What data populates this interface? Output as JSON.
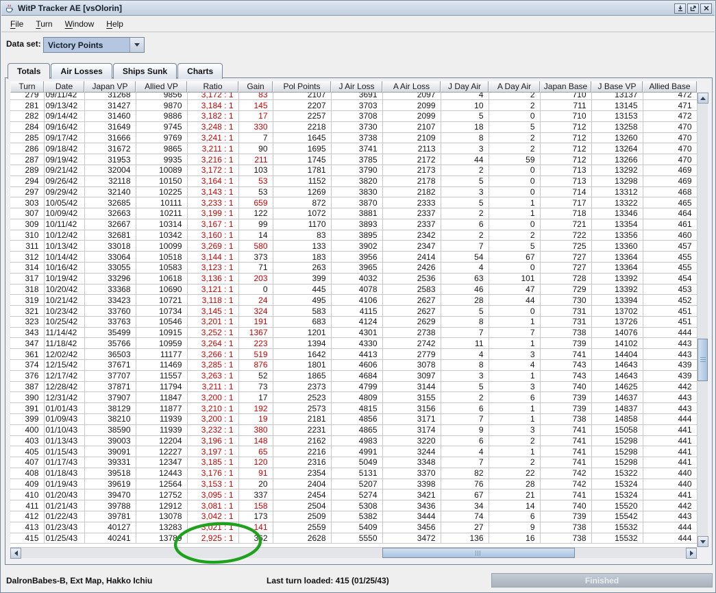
{
  "window": {
    "title": "WitP Tracker AE [vsOlorin]"
  },
  "menu": {
    "items": [
      {
        "label": "File",
        "mnemonic_index": 0
      },
      {
        "label": "Turn",
        "mnemonic_index": 0
      },
      {
        "label": "Window",
        "mnemonic_index": 0
      },
      {
        "label": "Help",
        "mnemonic_index": 0
      }
    ]
  },
  "dataset": {
    "label": "Data set:",
    "value": "Victory Points"
  },
  "tabs": [
    {
      "label": "Totals",
      "selected": true
    },
    {
      "label": "Air Losses",
      "selected": false
    },
    {
      "label": "Ships Sunk",
      "selected": false
    },
    {
      "label": "Charts",
      "selected": false
    }
  ],
  "table": {
    "columns": [
      "Turn",
      "Date",
      "Japan VP",
      "Allied VP",
      "Ratio",
      "Gain",
      "Pol Points",
      "J Air Loss",
      "A Air Loss",
      "J Day Air",
      "A Day Air",
      "Japan Base",
      "J Base VP",
      "Allied Base"
    ],
    "rows": [
      {
        "cells": [
          "279",
          "09/11/42",
          "31268",
          "9856",
          "3,172 : 1",
          "83",
          "2107",
          "3691",
          "2097",
          "4",
          "2",
          "710",
          "13137",
          "472"
        ],
        "gain_red": true
      },
      {
        "cells": [
          "281",
          "09/13/42",
          "31427",
          "9870",
          "3,184 : 1",
          "145",
          "2207",
          "3703",
          "2099",
          "10",
          "2",
          "711",
          "13145",
          "471"
        ],
        "gain_red": true
      },
      {
        "cells": [
          "282",
          "09/14/42",
          "31460",
          "9886",
          "3,182 : 1",
          "17",
          "2257",
          "3708",
          "2099",
          "5",
          "0",
          "710",
          "13153",
          "472"
        ],
        "gain_red": true
      },
      {
        "cells": [
          "284",
          "09/16/42",
          "31649",
          "9745",
          "3,248 : 1",
          "330",
          "2218",
          "3730",
          "2107",
          "18",
          "5",
          "712",
          "13258",
          "470"
        ],
        "gain_red": true
      },
      {
        "cells": [
          "285",
          "09/17/42",
          "31666",
          "9769",
          "3,241 : 1",
          "7",
          "1645",
          "3738",
          "2109",
          "8",
          "2",
          "712",
          "13260",
          "470"
        ],
        "gain_red": false
      },
      {
        "cells": [
          "286",
          "09/18/42",
          "31672",
          "9865",
          "3,211 : 1",
          "90",
          "1695",
          "3741",
          "2113",
          "3",
          "2",
          "712",
          "13264",
          "470"
        ],
        "gain_red": false
      },
      {
        "cells": [
          "287",
          "09/19/42",
          "31953",
          "9935",
          "3,216 : 1",
          "211",
          "1745",
          "3785",
          "2172",
          "44",
          "59",
          "712",
          "13266",
          "470"
        ],
        "gain_red": true
      },
      {
        "cells": [
          "289",
          "09/21/42",
          "32004",
          "10089",
          "3,172 : 1",
          "103",
          "1781",
          "3790",
          "2173",
          "2",
          "0",
          "713",
          "13292",
          "469"
        ],
        "gain_red": false
      },
      {
        "cells": [
          "294",
          "09/26/42",
          "32118",
          "10150",
          "3,164 : 1",
          "53",
          "1152",
          "3820",
          "2178",
          "5",
          "0",
          "713",
          "13298",
          "469"
        ],
        "gain_red": true
      },
      {
        "cells": [
          "297",
          "09/29/42",
          "32140",
          "10225",
          "3,143 : 1",
          "53",
          "1269",
          "3830",
          "2182",
          "3",
          "0",
          "714",
          "13312",
          "468"
        ],
        "gain_red": false
      },
      {
        "cells": [
          "303",
          "10/05/42",
          "32685",
          "10111",
          "3,233 : 1",
          "659",
          "872",
          "3870",
          "2333",
          "5",
          "1",
          "717",
          "13322",
          "465"
        ],
        "gain_red": true
      },
      {
        "cells": [
          "307",
          "10/09/42",
          "32663",
          "10211",
          "3,199 : 1",
          "122",
          "1072",
          "3881",
          "2337",
          "2",
          "1",
          "718",
          "13346",
          "464"
        ],
        "gain_red": false
      },
      {
        "cells": [
          "309",
          "10/11/42",
          "32667",
          "10314",
          "3,167 : 1",
          "99",
          "1170",
          "3893",
          "2337",
          "6",
          "0",
          "721",
          "13354",
          "461"
        ],
        "gain_red": false
      },
      {
        "cells": [
          "310",
          "10/12/42",
          "32681",
          "10342",
          "3,160 : 1",
          "14",
          "83",
          "3895",
          "2342",
          "2",
          "2",
          "722",
          "13356",
          "460"
        ],
        "gain_red": false
      },
      {
        "cells": [
          "311",
          "10/13/42",
          "33018",
          "10099",
          "3,269 : 1",
          "580",
          "133",
          "3902",
          "2347",
          "7",
          "5",
          "725",
          "13360",
          "457"
        ],
        "gain_red": true
      },
      {
        "cells": [
          "312",
          "10/14/42",
          "33064",
          "10518",
          "3,144 : 1",
          "373",
          "183",
          "3956",
          "2414",
          "54",
          "67",
          "727",
          "13364",
          "455"
        ],
        "gain_red": false
      },
      {
        "cells": [
          "314",
          "10/16/42",
          "33055",
          "10583",
          "3,123 : 1",
          "71",
          "263",
          "3965",
          "2426",
          "4",
          "0",
          "727",
          "13364",
          "455"
        ],
        "gain_red": false
      },
      {
        "cells": [
          "317",
          "10/19/42",
          "33296",
          "10618",
          "3,136 : 1",
          "203",
          "399",
          "4032",
          "2536",
          "63",
          "101",
          "728",
          "13392",
          "454"
        ],
        "gain_red": true
      },
      {
        "cells": [
          "318",
          "10/20/42",
          "33368",
          "10690",
          "3,121 : 1",
          "0",
          "445",
          "4078",
          "2583",
          "46",
          "47",
          "729",
          "13392",
          "453"
        ],
        "gain_red": false
      },
      {
        "cells": [
          "319",
          "10/21/42",
          "33423",
          "10721",
          "3,118 : 1",
          "24",
          "495",
          "4106",
          "2627",
          "28",
          "44",
          "730",
          "13394",
          "452"
        ],
        "gain_red": true
      },
      {
        "cells": [
          "321",
          "10/23/42",
          "33760",
          "10734",
          "3,145 : 1",
          "324",
          "583",
          "4115",
          "2627",
          "5",
          "0",
          "731",
          "13702",
          "451"
        ],
        "gain_red": true
      },
      {
        "cells": [
          "323",
          "10/25/42",
          "33763",
          "10546",
          "3,201 : 1",
          "191",
          "683",
          "4124",
          "2629",
          "8",
          "1",
          "731",
          "13726",
          "451"
        ],
        "gain_red": true
      },
      {
        "cells": [
          "343",
          "11/14/42",
          "35499",
          "10915",
          "3,252 : 1",
          "1367",
          "1201",
          "4301",
          "2738",
          "7",
          "7",
          "738",
          "14076",
          "444"
        ],
        "gain_red": true
      },
      {
        "cells": [
          "347",
          "11/18/42",
          "35766",
          "10959",
          "3,264 : 1",
          "223",
          "1394",
          "4330",
          "2742",
          "11",
          "1",
          "739",
          "14102",
          "443"
        ],
        "gain_red": true
      },
      {
        "cells": [
          "361",
          "12/02/42",
          "36503",
          "11177",
          "3,266 : 1",
          "519",
          "1642",
          "4413",
          "2779",
          "4",
          "3",
          "741",
          "14404",
          "443"
        ],
        "gain_red": true
      },
      {
        "cells": [
          "374",
          "12/15/42",
          "37671",
          "11469",
          "3,285 : 1",
          "876",
          "1801",
          "4606",
          "3078",
          "8",
          "4",
          "743",
          "14643",
          "439"
        ],
        "gain_red": true
      },
      {
        "cells": [
          "376",
          "12/17/42",
          "37707",
          "11557",
          "3,263 : 1",
          "52",
          "1865",
          "4684",
          "3097",
          "3",
          "1",
          "743",
          "14643",
          "439"
        ],
        "gain_red": false
      },
      {
        "cells": [
          "387",
          "12/28/42",
          "37871",
          "11794",
          "3,211 : 1",
          "73",
          "2373",
          "4799",
          "3144",
          "5",
          "3",
          "740",
          "14625",
          "442"
        ],
        "gain_red": false
      },
      {
        "cells": [
          "390",
          "12/31/42",
          "37907",
          "11847",
          "3,200 : 1",
          "17",
          "2523",
          "4809",
          "3155",
          "2",
          "6",
          "739",
          "14637",
          "443"
        ],
        "gain_red": false
      },
      {
        "cells": [
          "391",
          "01/01/43",
          "38129",
          "11877",
          "3,210 : 1",
          "192",
          "2573",
          "4815",
          "3156",
          "6",
          "1",
          "739",
          "14837",
          "443"
        ],
        "gain_red": true
      },
      {
        "cells": [
          "399",
          "01/09/43",
          "38210",
          "11939",
          "3,200 : 1",
          "19",
          "2181",
          "4856",
          "3171",
          "7",
          "1",
          "738",
          "14858",
          "444"
        ],
        "gain_red": true
      },
      {
        "cells": [
          "400",
          "01/10/43",
          "38590",
          "11939",
          "3,232 : 1",
          "380",
          "2231",
          "4865",
          "3174",
          "9",
          "3",
          "741",
          "15058",
          "441"
        ],
        "gain_red": true
      },
      {
        "cells": [
          "403",
          "01/13/43",
          "39003",
          "12204",
          "3,196 : 1",
          "148",
          "2162",
          "4983",
          "3220",
          "6",
          "2",
          "741",
          "15298",
          "441"
        ],
        "gain_red": true
      },
      {
        "cells": [
          "405",
          "01/15/43",
          "39091",
          "12227",
          "3,197 : 1",
          "65",
          "2216",
          "4991",
          "3244",
          "4",
          "1",
          "741",
          "15298",
          "441"
        ],
        "gain_red": true
      },
      {
        "cells": [
          "407",
          "01/17/43",
          "39331",
          "12347",
          "3,185 : 1",
          "120",
          "2316",
          "5049",
          "3348",
          "7",
          "2",
          "741",
          "15298",
          "441"
        ],
        "gain_red": true
      },
      {
        "cells": [
          "408",
          "01/18/43",
          "39518",
          "12443",
          "3,176 : 1",
          "91",
          "2354",
          "5131",
          "3370",
          "82",
          "22",
          "742",
          "15322",
          "440"
        ],
        "gain_red": true
      },
      {
        "cells": [
          "409",
          "01/19/43",
          "39619",
          "12564",
          "3,153 : 1",
          "20",
          "2404",
          "5207",
          "3398",
          "76",
          "28",
          "742",
          "15324",
          "440"
        ],
        "gain_red": false
      },
      {
        "cells": [
          "410",
          "01/20/43",
          "39470",
          "12752",
          "3,095 : 1",
          "337",
          "2454",
          "5274",
          "3421",
          "67",
          "21",
          "741",
          "15324",
          "441"
        ],
        "gain_red": false
      },
      {
        "cells": [
          "411",
          "01/21/43",
          "39788",
          "12912",
          "3,081 : 1",
          "158",
          "2504",
          "5308",
          "3436",
          "34",
          "14",
          "740",
          "15520",
          "442"
        ],
        "gain_red": true
      },
      {
        "cells": [
          "412",
          "01/22/43",
          "39781",
          "13078",
          "3,042 : 1",
          "173",
          "2509",
          "5382",
          "3444",
          "74",
          "6",
          "739",
          "15542",
          "443"
        ],
        "gain_red": false
      },
      {
        "cells": [
          "413",
          "01/23/43",
          "40127",
          "13283",
          "3,021 : 1",
          "141",
          "2559",
          "5409",
          "3456",
          "27",
          "9",
          "738",
          "15532",
          "444"
        ],
        "gain_red": true
      },
      {
        "cells": [
          "415",
          "01/25/43",
          "40241",
          "13789",
          "2,925 : 1",
          "362",
          "2628",
          "5550",
          "3472",
          "136",
          "16",
          "738",
          "15532",
          "444"
        ],
        "gain_red": false
      }
    ]
  },
  "statusbar": {
    "left": "DalronBabes-B, Ext Map, Hakko Ichiu",
    "center": "Last turn loaded: 415 (01/25/43)",
    "progress_label": "Finished"
  },
  "annotation": {
    "shape": "ellipse",
    "note": "hand-drawn circle around ratio 2,925 : 1"
  },
  "colors": {
    "negative_red": "#cc0000",
    "annotation_green": "#1ea21e",
    "titlebar_blue": "#c2cfdf",
    "combo_blue": "#b4c6e0"
  }
}
